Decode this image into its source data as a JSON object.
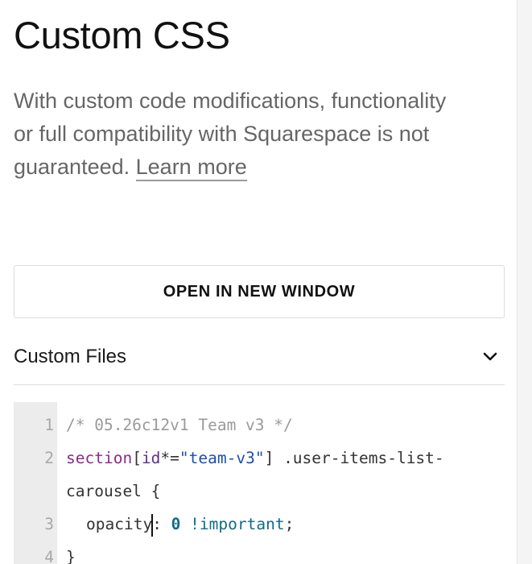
{
  "header": {
    "title": "Custom CSS",
    "description": "With custom code modifications, functionality or full compatibility with Squarespace is not guaranteed.",
    "learn_more_link": "Learn more"
  },
  "open_window_button": {
    "label": "OPEN IN NEW WINDOW"
  },
  "custom_files": {
    "label": "Custom Files",
    "toggle_icon": "chevron-down-icon"
  },
  "editor": {
    "lines": [
      {
        "number": "1",
        "text": "/* 05.26c12v1 Team v3 */"
      },
      {
        "number": "2",
        "selector": "section",
        "bracket_open": "[",
        "attr": "id",
        "op": "*=",
        "value": "\"team-v3\"",
        "bracket_close": "]",
        "rest": " .user-items-list-",
        "continuation": "carousel {"
      },
      {
        "number": "3",
        "property": "opacity",
        "colon": ": ",
        "num": "0",
        "important": "!important",
        "semicolon": ";"
      },
      {
        "number": "4",
        "text": "}"
      }
    ]
  },
  "colors": {
    "title": "#111111",
    "description": "#666666",
    "gutter_bg": "#ececec",
    "line_number": "#a8a8a8",
    "comment": "#9a9a9a",
    "selector": "#8a2a8a",
    "string": "#1d4fa8",
    "number": "#0f6d86"
  }
}
